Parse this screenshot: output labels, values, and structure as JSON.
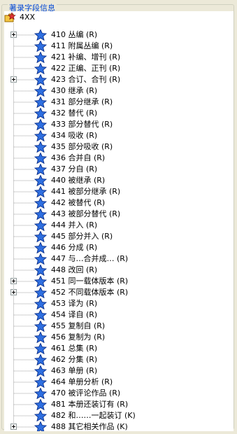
{
  "group_title": "著录字段信息",
  "root": {
    "label": "4XX"
  },
  "items": [
    {
      "label": "410 丛编 (R)",
      "expandable": true
    },
    {
      "label": "411 附属丛编 (R)",
      "expandable": false
    },
    {
      "label": "421 补编、增刊 (R)",
      "expandable": false
    },
    {
      "label": "422 正编、正刊 (R)",
      "expandable": false
    },
    {
      "label": "423 合订、合刊 (R)",
      "expandable": true
    },
    {
      "label": "430 继承 (R)",
      "expandable": false
    },
    {
      "label": "431 部分继承 (R)",
      "expandable": false
    },
    {
      "label": "432 替代 (R)",
      "expandable": false
    },
    {
      "label": "433 部分替代 (R)",
      "expandable": false
    },
    {
      "label": "434 吸收 (R)",
      "expandable": false
    },
    {
      "label": "435 部分吸收 (R)",
      "expandable": false
    },
    {
      "label": "436 合并自 (R)",
      "expandable": false
    },
    {
      "label": "437 分自 (R)",
      "expandable": false
    },
    {
      "label": "440 被继承 (R)",
      "expandable": false
    },
    {
      "label": "441 被部分继承 (R)",
      "expandable": false
    },
    {
      "label": "442 被替代 (R)",
      "expandable": false
    },
    {
      "label": "443 被部分替代 (R)",
      "expandable": false
    },
    {
      "label": "444 并入 (R)",
      "expandable": false
    },
    {
      "label": "445 部分并入 (R)",
      "expandable": false
    },
    {
      "label": "446 分成 (R)",
      "expandable": false
    },
    {
      "label": "447 与…合并成… (R)",
      "expandable": false
    },
    {
      "label": "448 改回 (R)",
      "expandable": false
    },
    {
      "label": "451 同一载体版本 (R)",
      "expandable": true
    },
    {
      "label": "452 不同载体版本 (R)",
      "expandable": true
    },
    {
      "label": "453 译为 (R)",
      "expandable": false
    },
    {
      "label": "454 译自 (R)",
      "expandable": false
    },
    {
      "label": "455 复制自 (R)",
      "expandable": false
    },
    {
      "label": "456 复制为 (R)",
      "expandable": false
    },
    {
      "label": "461 总集 (R)",
      "expandable": false
    },
    {
      "label": "462 分集 (R)",
      "expandable": false
    },
    {
      "label": "463 单册 (R)",
      "expandable": false
    },
    {
      "label": "464 单册分析 (R)",
      "expandable": false
    },
    {
      "label": "470 被评论作品 (R)",
      "expandable": false
    },
    {
      "label": "481 本册还装订有 (R)",
      "expandable": false
    },
    {
      "label": "482 和……一起装订 (K)",
      "expandable": false
    },
    {
      "label": "488 其它相关作品 (K)",
      "expandable": true
    }
  ],
  "colors": {
    "star_fill": "#2f6fe0",
    "star_edge": "#0b2f8a",
    "tree_line": "#a0a0a0",
    "title": "#0046d5"
  },
  "icons": {
    "root": "folder-star-icon",
    "item": "star-icon",
    "expander": "plus-expander-icon"
  }
}
